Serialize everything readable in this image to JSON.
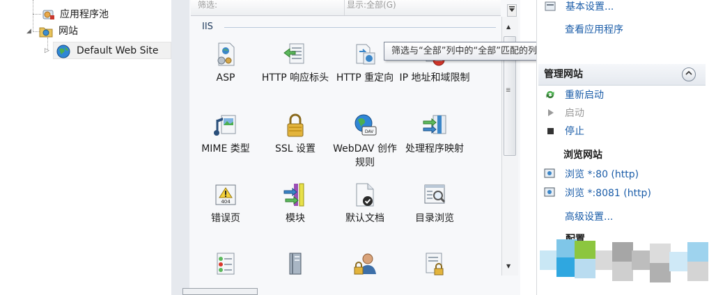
{
  "tree": {
    "app_pools": "应用程序池",
    "sites": "网站",
    "default_site": "Default Web Site"
  },
  "center": {
    "column_filter": "筛选:",
    "column_show": "显示:全部(G)",
    "group_label": "IIS",
    "features": [
      {
        "label": "ASP",
        "icon": "asp-icon"
      },
      {
        "label": "HTTP 响应标头",
        "icon": "http-response-headers-icon"
      },
      {
        "label": "HTTP 重定向",
        "icon": "http-redirect-icon"
      },
      {
        "label": "IP 地址和域限制",
        "icon": "ip-domain-restrictions-icon"
      },
      {
        "label": "MIME 类型",
        "icon": "mime-types-icon"
      },
      {
        "label": "SSL 设置",
        "icon": "ssl-lock-icon"
      },
      {
        "label": "WebDAV 创作规则",
        "icon": "webdav-icon"
      },
      {
        "label": "处理程序映射",
        "icon": "handler-mappings-icon"
      },
      {
        "label": "错误页",
        "icon": "error-pages-icon"
      },
      {
        "label": "模块",
        "icon": "modules-icon"
      },
      {
        "label": "默认文档",
        "icon": "default-document-icon"
      },
      {
        "label": "目录浏览",
        "icon": "directory-browsing-icon"
      },
      {
        "label": "",
        "icon": "feature-list-icon"
      },
      {
        "label": "",
        "icon": "feature-book-icon"
      },
      {
        "label": "",
        "icon": "feature-user-lock-icon"
      },
      {
        "label": "",
        "icon": "feature-doc-lock-icon"
      }
    ],
    "tooltip": "筛选与“全部”列中的“全部”匹配的列表条目。"
  },
  "actions": {
    "basic_settings": "基本设置...",
    "view_apps": "查看应用程序",
    "manage_site": "管理网站",
    "restart": "重新启动",
    "start": "启动",
    "stop": "停止",
    "browse_site": "浏览网站",
    "browse_80": "浏览 *:80 (http)",
    "browse_8081": "浏览 *:8081 (http)",
    "advanced": "高级设置...",
    "config": "配置"
  },
  "colors": {
    "link": "#1a5ca8",
    "disabled": "#9a9a9a",
    "tooltip_border": "#7d8696"
  }
}
